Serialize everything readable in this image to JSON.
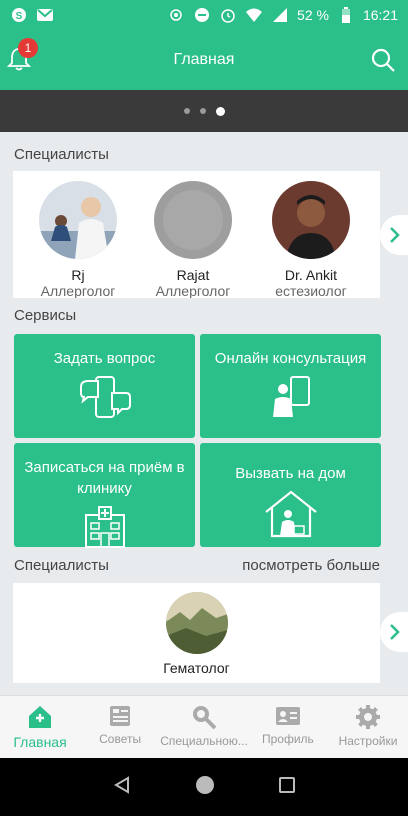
{
  "status_bar": {
    "battery": "52 %",
    "time": "16:21"
  },
  "header": {
    "title": "Главная",
    "badge_count": "1"
  },
  "specialists_section": {
    "title": "Специалисты",
    "items": [
      {
        "name": "Rj",
        "role": "Аллерголог"
      },
      {
        "name": "Rajat",
        "role": "Аллерголог"
      },
      {
        "name": "Dr. Ankit",
        "role": "естезиолог"
      }
    ]
  },
  "services_section": {
    "title": "Сервисы",
    "items": [
      {
        "label": "Задать вопрос"
      },
      {
        "label": "Онлайн консультация"
      },
      {
        "label": "Записаться на приём в клинику"
      },
      {
        "label": "Вызвать на дом"
      }
    ]
  },
  "specialists_section_2": {
    "title": "Специалисты",
    "see_more": "посмотреть больше",
    "item": {
      "name": "Гематолог"
    }
  },
  "bottom_nav": [
    {
      "label": "Главная",
      "active": true
    },
    {
      "label": "Советы"
    },
    {
      "label": "Специальною..."
    },
    {
      "label": "Профиль"
    },
    {
      "label": "Настройки"
    }
  ],
  "colors": {
    "primary": "#2bbf8a",
    "badge": "#e53935"
  }
}
